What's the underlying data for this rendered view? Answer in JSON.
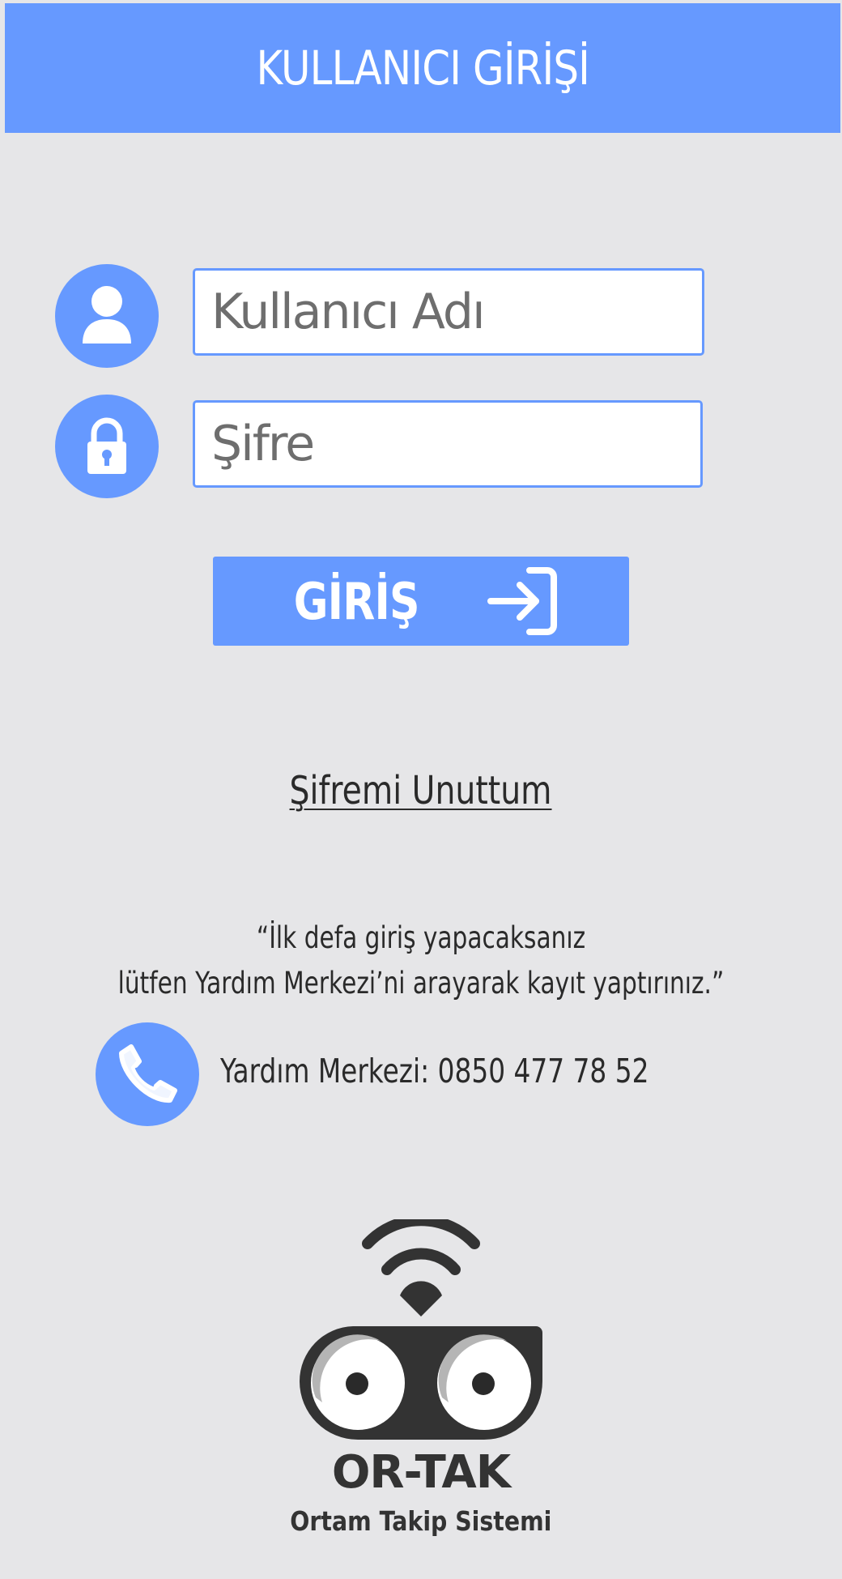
{
  "header": {
    "title": "KULLANICI GİRİŞİ"
  },
  "form": {
    "username_placeholder": "Kullanıcı Adı",
    "password_placeholder": "Şifre",
    "username_value": "",
    "password_value": "",
    "login_label": "GİRİŞ"
  },
  "forgot_password_label": "Şifremi Unuttum",
  "note": {
    "line1": "“İlk defa giriş yapacaksanız",
    "line2": "lütfen Yardım Merkezi’ni arayarak kayıt yaptırınız.”"
  },
  "help_center": {
    "text": "Yardım Merkezi: 0850 477 78 52"
  },
  "brand": {
    "name": "OR-TAK",
    "tagline": "Ortam Takip Sistemi"
  },
  "icons": {
    "username": "user-icon",
    "password": "lock-icon",
    "login": "sign-in-arrow-icon",
    "phone": "phone-icon",
    "logo": "owl-eyes-wifi-logo"
  },
  "colors": {
    "accent": "#6699ff",
    "background": "#e6e6e8",
    "text": "#2a2a2a",
    "brand": "#333333"
  }
}
